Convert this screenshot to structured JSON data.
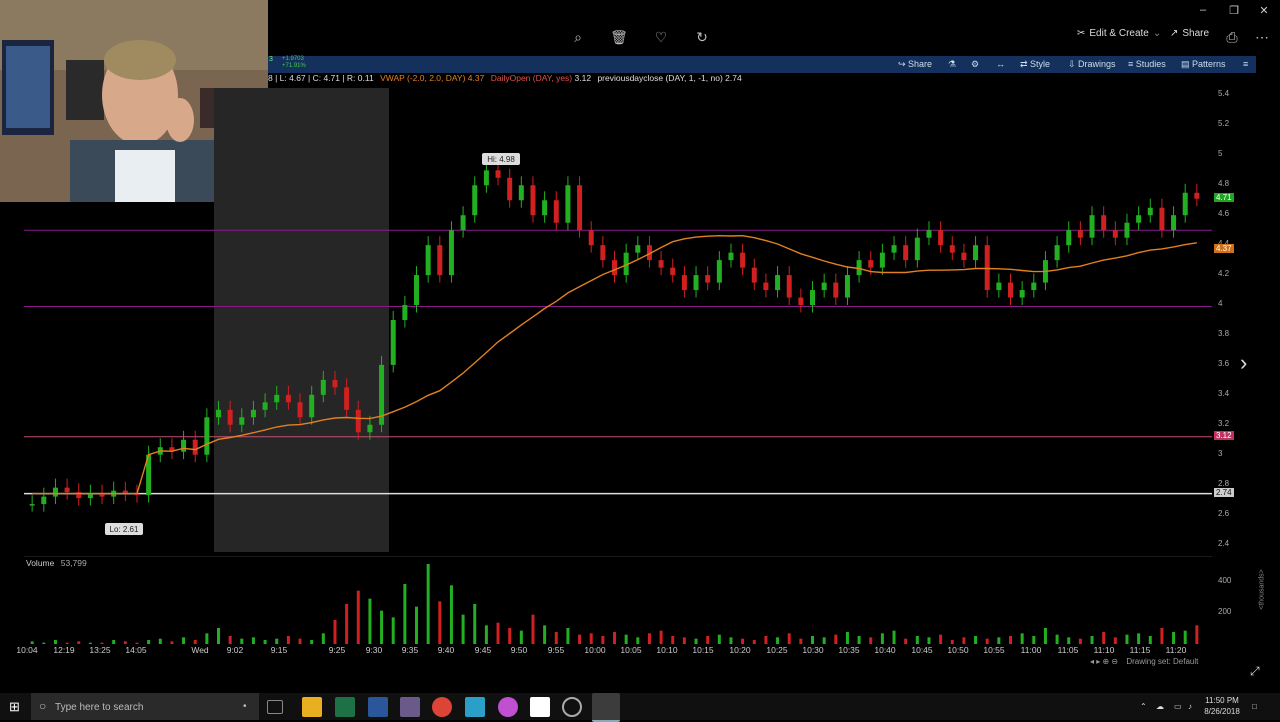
{
  "header": {
    "edit_create": "Edit & Create",
    "share": "Share",
    "icons": [
      "zoom-icon",
      "trash-icon",
      "heart-icon",
      "rotate-icon"
    ]
  },
  "toolbar": {
    "share": "Share",
    "style": "Style",
    "drawings": "Drawings",
    "studies": "Studies",
    "patterns": "Patterns",
    "quote_up": "+1.9703",
    "quote_pct": "+71.91%",
    "left_char": "3"
  },
  "legend": {
    "ohlc": "8 | L: 4.67 | C: 4.71 | R: 0.11",
    "vwap": "VWAP (-2.0, 2.0, DAY)",
    "vwap_val": "4.37",
    "dayopen": "DailyOpen (DAY, yes)",
    "dayopen_val": "3.12",
    "prevclose": "previousdayclose (DAY, 1, -1, no)",
    "prevclose_val": "2.74"
  },
  "labels": {
    "hi": "Hi: 4.98",
    "lo": "Lo: 2.61"
  },
  "volume": {
    "label": "Volume",
    "value": "53,799",
    "axis": [
      "400",
      "200"
    ],
    "unit": "<thousands>"
  },
  "price_axis": {
    "ticks": [
      "5.4",
      "5.2",
      "5",
      "4.8",
      "4.6",
      "4.4",
      "4.2",
      "4",
      "3.8",
      "3.6",
      "3.4",
      "3.2",
      "3",
      "2.8",
      "2.6",
      "2.4"
    ],
    "last": "4.71",
    "vwap": "4.37",
    "open": "3.12",
    "prevclose": "2.74"
  },
  "time_axis": {
    "labels": [
      "10:04",
      "12:19",
      "13:25",
      "14:05",
      "Wed",
      "9:02",
      "9:15",
      "9:25",
      "9:30",
      "9:35",
      "9:40",
      "9:45",
      "9:50",
      "9:55",
      "10:00",
      "10:05",
      "10:10",
      "10:15",
      "10:20",
      "10:25",
      "10:30",
      "10:35",
      "10:40",
      "10:45",
      "10:50",
      "10:55",
      "11:00",
      "11:05",
      "11:10",
      "11:15",
      "11:20"
    ]
  },
  "status": {
    "drawing_set": "Drawing set: Default"
  },
  "taskbar": {
    "search_placeholder": "Type here to search",
    "time": "11:50 PM",
    "date": "8/26/2018"
  },
  "colors": {
    "up": "#22b022",
    "down": "#d02020",
    "vwap": "#e08020",
    "level_purple": "#8a1a8a",
    "level_pink": "#c05070",
    "prevclose": "#dddddd",
    "toolbar_bg": "#14305c"
  },
  "chart_data": {
    "type": "candlestick",
    "hi": 4.98,
    "lo": 2.61,
    "ylim": [
      2.35,
      5.45
    ],
    "levels": [
      4.5,
      3.99,
      3.12,
      2.74
    ],
    "vwap_last": 4.37,
    "last": 4.71,
    "close_series": [
      2.67,
      2.72,
      2.78,
      2.75,
      2.71,
      2.74,
      2.72,
      2.76,
      2.74,
      2.73,
      3.0,
      3.05,
      3.02,
      3.1,
      3.0,
      3.25,
      3.3,
      3.2,
      3.25,
      3.3,
      3.35,
      3.4,
      3.35,
      3.25,
      3.4,
      3.5,
      3.45,
      3.3,
      3.15,
      3.2,
      3.6,
      3.9,
      4.0,
      4.2,
      4.4,
      4.2,
      4.5,
      4.6,
      4.8,
      4.9,
      4.85,
      4.7,
      4.8,
      4.6,
      4.7,
      4.55,
      4.8,
      4.5,
      4.4,
      4.3,
      4.2,
      4.35,
      4.4,
      4.3,
      4.25,
      4.2,
      4.1,
      4.2,
      4.15,
      4.3,
      4.35,
      4.25,
      4.15,
      4.1,
      4.2,
      4.05,
      4.0,
      4.1,
      4.15,
      4.05,
      4.2,
      4.3,
      4.25,
      4.35,
      4.4,
      4.3,
      4.45,
      4.5,
      4.4,
      4.35,
      4.3,
      4.4,
      4.1,
      4.15,
      4.05,
      4.1,
      4.15,
      4.3,
      4.4,
      4.5,
      4.45,
      4.6,
      4.5,
      4.45,
      4.55,
      4.6,
      4.65,
      4.5,
      4.6,
      4.75,
      4.71
    ],
    "volume": [
      2,
      1,
      3,
      1,
      2,
      1,
      1,
      3,
      2,
      1,
      3,
      4,
      2,
      5,
      3,
      8,
      12,
      6,
      4,
      5,
      3,
      4,
      6,
      4,
      3,
      8,
      18,
      30,
      40,
      34,
      25,
      20,
      45,
      28,
      60,
      32,
      44,
      22,
      30,
      14,
      16,
      12,
      10,
      22,
      14,
      9,
      12,
      7,
      8,
      6,
      9,
      7,
      5,
      8,
      10,
      6,
      5,
      4,
      6,
      7,
      5,
      4,
      3,
      6,
      5,
      8,
      4,
      6,
      5,
      7,
      9,
      6,
      5,
      8,
      10,
      4,
      6,
      5,
      7,
      3,
      5,
      6,
      4,
      5,
      6,
      8,
      6,
      12,
      7,
      5,
      4,
      6,
      9,
      5,
      7,
      8,
      6,
      12,
      9,
      10,
      14
    ]
  }
}
